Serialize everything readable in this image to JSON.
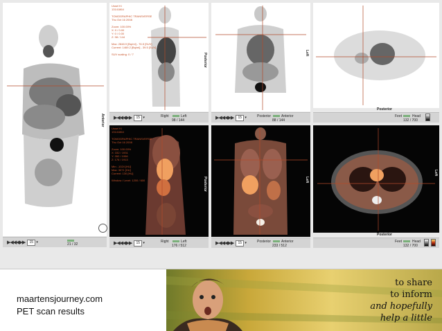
{
  "viewer": {
    "mip_panel": {
      "orientation_right": "Anterior",
      "slice_count": "21 / 32",
      "zoom": "15"
    },
    "pet_sagittal": {
      "info_lines": [
        "Ussel Ki",
        "13141864",
        "",
        "TOMOGRAPHIC TRANSVERSE",
        "Thu Oct 16 2008",
        "",
        "Zoom: 100.00%",
        "X: 0 / 0.00",
        "Y: 0 / 0.00",
        "Z: 98 / 144",
        "",
        "Max: 2848.9 [Bq/ml] - 76.5 [SUV]",
        "Current: 1469.2 [Bq/ml] - 39.5 [SUV]",
        "",
        "SUV scaling: 0 / 7"
      ],
      "orientation_right": "Posterior",
      "dir_left": "Right",
      "dir_right": "Left",
      "slice_count": "98 / 144",
      "zoom": "15"
    },
    "pet_coronal": {
      "orientation_right": "Left",
      "dir_left": "Posterior",
      "dir_right": "Anterior",
      "slice_count": "88 / 144",
      "zoom": "15"
    },
    "pet_axial": {
      "orientation_top": "Posterior",
      "dir_left": "Feet",
      "dir_right": "Head",
      "slice_count": "132 / 700",
      "zoom": "15"
    },
    "fused_sagittal": {
      "info_lines": [
        "Ussel Ki",
        "13141864",
        "",
        "TOMOGRAPHIC TRANSVERSE",
        "Thu Oct 16 2008",
        "",
        "Zoom: 100.00%",
        "X: 332 / 1931",
        "Y: 352 / 1956",
        "Z: 176 / 1913",
        "",
        "Min: -1024 [HU]",
        "Max: 3071 [HU]",
        "Current: 130 [HU]",
        "",
        "Window / Level: 1200 / 600"
      ],
      "orientation_right": "Posterior",
      "dir_left": "Right",
      "dir_right": "Left",
      "slice_count": "176 / 512",
      "zoom": "15"
    },
    "fused_coronal": {
      "orientation_right": "Left",
      "dir_left": "Posterior",
      "dir_right": "Anterior",
      "slice_count": "233 / 512",
      "zoom": "15"
    },
    "fused_axial": {
      "orientation_top": "Posterior",
      "orientation_right": "Left",
      "dir_left": "Feet",
      "dir_right": "Head",
      "slice_count": "132 / 700",
      "zoom": "15"
    },
    "playback_glyphs": "▶◀◀◀▶▶",
    "colors": {
      "crosshair": "#b34a2a",
      "info_text": "#c8542a",
      "panel_bg": "#ffffff",
      "dark_bg": "#050505"
    }
  },
  "caption": {
    "line1": "maartensjourney.com",
    "line2": "PET scan results"
  },
  "tagline": {
    "line1": "to share",
    "line2": "to inform",
    "line3": "and hopefully",
    "line4": "help a little"
  },
  "icons": [
    "play-icon",
    "rewind-icon",
    "fast-forward-icon",
    "circle-button-icon",
    "colormap-swatch-icon"
  ]
}
